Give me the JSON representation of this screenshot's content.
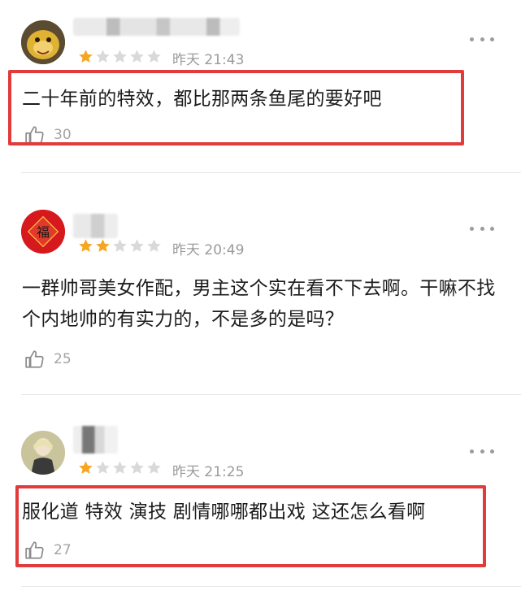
{
  "reviews": [
    {
      "date": "昨天 21:43",
      "rating": 1,
      "text": "二十年前的特效，都比那两条鱼尾的要好吧",
      "likes": "30"
    },
    {
      "date": "昨天 20:49",
      "rating": 2,
      "text": "一群帅哥美女作配，男主这个实在看不下去啊。干嘛不找个内地帅的有实力的，不是多的是吗？",
      "likes": "25",
      "avatar_char": "福"
    },
    {
      "date": "昨天 21:25",
      "rating": 1,
      "text": "服化道 特效 演技 剧情哪哪都出戏 这还怎么看啊",
      "likes": "27"
    }
  ],
  "colors": {
    "star_filled": "#f6a623",
    "star_empty": "#d9d9d9",
    "highlight": "#e23b3b"
  },
  "icons": [
    "more-dots-icon",
    "thumbs-up-icon",
    "star-icon"
  ]
}
